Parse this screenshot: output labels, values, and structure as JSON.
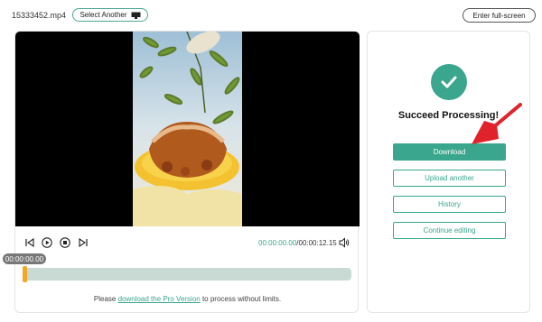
{
  "header": {
    "filename": "15333452.mp4",
    "select_label": "Select Another",
    "fullscreen_label": "Enter full-screen"
  },
  "player": {
    "current_time": "00:00:00.00",
    "total_time": "/00:00:12.15",
    "badge_time": "00:00:00.00",
    "progress": 0,
    "promo_prefix": "Please ",
    "promo_link": "download the Pro Version",
    "promo_suffix": " to process without limits."
  },
  "result": {
    "title": "Succeed Processing!",
    "download_label": "Download",
    "upload_label": "Upload another",
    "history_label": "History",
    "continue_label": "Continue editing"
  },
  "colors": {
    "accent": "#3aa68d",
    "handle": "#f5a623",
    "arrow": "#e0232a"
  }
}
